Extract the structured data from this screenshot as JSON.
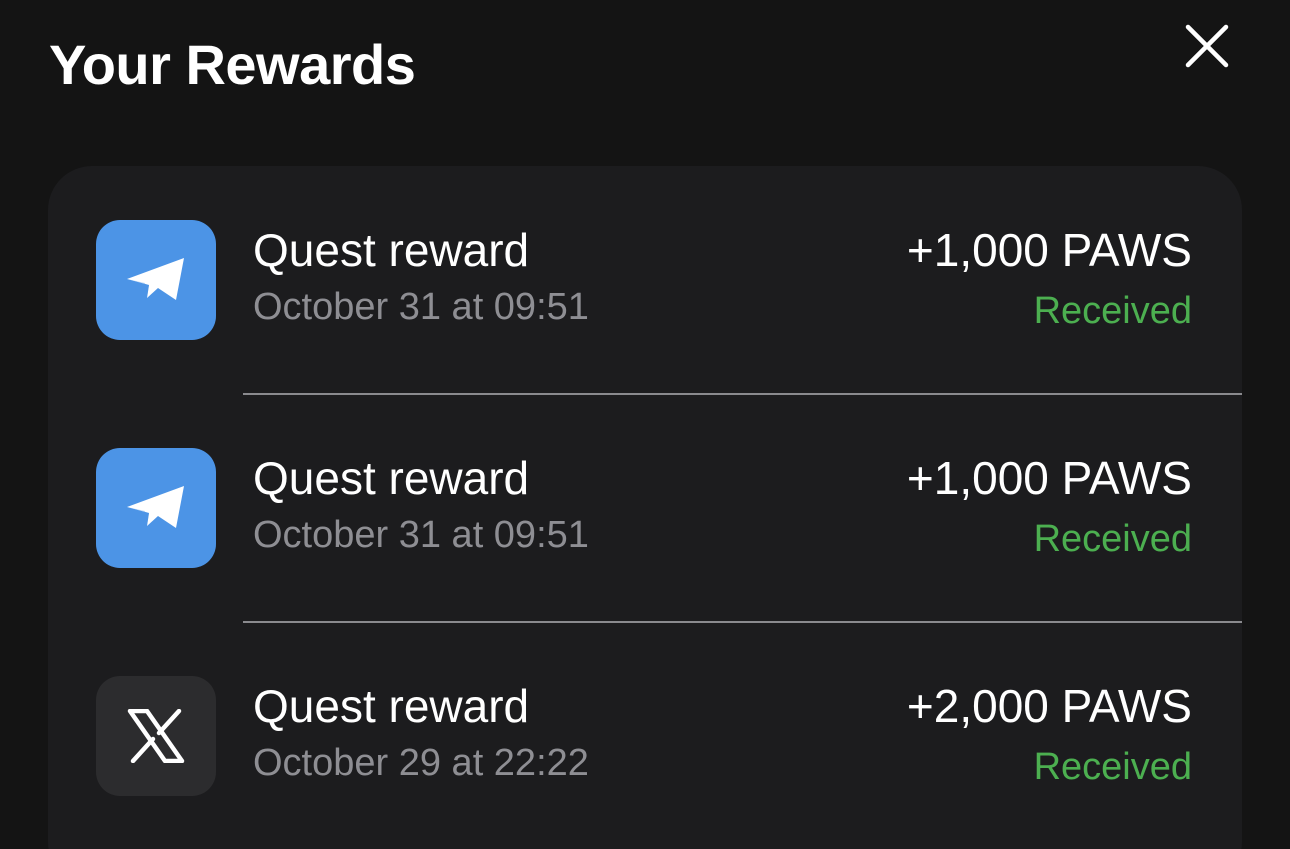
{
  "header": {
    "title": "Your Rewards"
  },
  "close": {
    "icon": "close-icon"
  },
  "rewards": [
    {
      "icon": "telegram-icon",
      "name": "Quest reward",
      "date": "October 31 at 09:51",
      "amount": "+1,000 PAWS",
      "status": "Received"
    },
    {
      "icon": "telegram-icon",
      "name": "Quest reward",
      "date": "October 31 at 09:51",
      "amount": "+1,000 PAWS",
      "status": "Received"
    },
    {
      "icon": "x-logo-icon",
      "name": "Quest reward",
      "date": "October 29 at 22:22",
      "amount": "+2,000 PAWS",
      "status": "Received"
    }
  ],
  "colors": {
    "background": "#141414",
    "card": "#1c1c1e",
    "telegram_blue": "#4c94e6",
    "x_tile": "#2c2c2e",
    "received_green": "#4caf50",
    "secondary_text": "#8e8e93"
  }
}
